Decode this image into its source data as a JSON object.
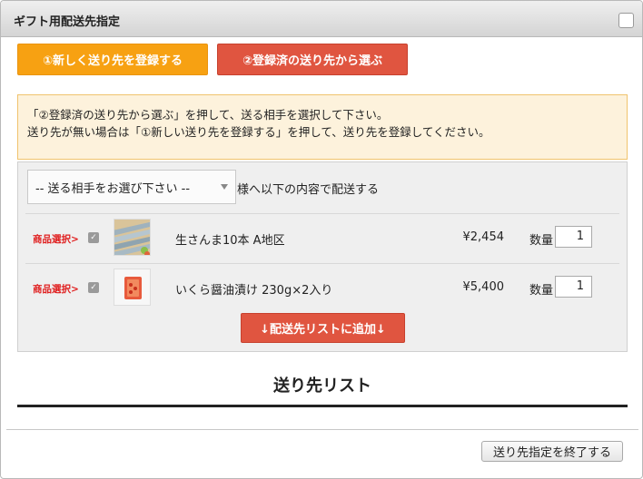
{
  "window": {
    "title": "ギフト用配送先指定"
  },
  "actions": {
    "new_destination": "①新しく送り先を登録する",
    "registered_destination": "②登録済の送り先から選ぶ"
  },
  "notice": {
    "line1": "「②登録済の送り先から選ぶ」を押して、送る相手を選択して下さい。",
    "line2": "送り先が無い場合は「①新しい送り先を登録する」を押して、送り先を登録してください。"
  },
  "recipient": {
    "select_value": "-- 送る相手をお選び下さい --",
    "suffix": "様へ以下の内容で配送する"
  },
  "items": [
    {
      "pick_label": "商品選択>",
      "checked": true,
      "name": "生さんま10本 A地区",
      "price": "¥2,454",
      "qty_label": "数量",
      "qty": "1",
      "thumb_icon": "saury-fish-icon"
    },
    {
      "pick_label": "商品選択>",
      "checked": true,
      "name": "いくら醤油漬け 230g×2入り",
      "price": "¥5,400",
      "qty_label": "数量",
      "qty": "1",
      "thumb_icon": "salmon-roe-icon"
    }
  ],
  "add_button": "↓配送先リストに追加↓",
  "list_title": "送り先リスト",
  "finish_button": "送り先指定を終了する",
  "colors": {
    "orange": "#f7a112",
    "red": "#e05540",
    "notice_bg": "#fdf2dc",
    "notice_border": "#f0c36d",
    "pick_red": "#e02020"
  }
}
